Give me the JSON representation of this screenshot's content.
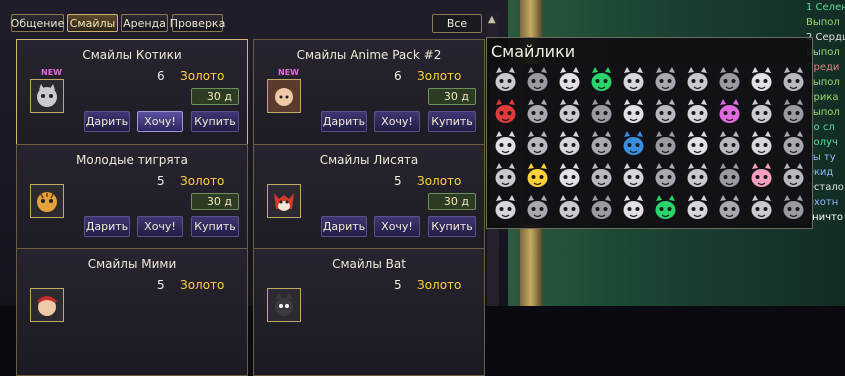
{
  "tabs": [
    {
      "label": "Общение"
    },
    {
      "label": "Смайлы"
    },
    {
      "label": "Аренда"
    },
    {
      "label": "Проверка"
    }
  ],
  "all_label": "Все",
  "cards": [
    {
      "title": "Смайлы Котики",
      "new": "NEW",
      "count": "6",
      "currency": "Золото",
      "price": "30 д",
      "icon": "cat-smile-icon",
      "gift": "Дарить",
      "want": "Хочу!",
      "buy": "Купить"
    },
    {
      "title": "Смайлы Anime Pack #2",
      "new": "NEW",
      "count": "6",
      "currency": "Золото",
      "price": "30 д",
      "icon": "anime-girl-icon",
      "gift": "Дарить",
      "want": "Хочу!",
      "buy": "Купить"
    },
    {
      "title": "Молодые тигрята",
      "count": "5",
      "currency": "Золото",
      "price": "30 д",
      "icon": "tiger-cub-icon",
      "gift": "Дарить",
      "want": "Хочу!",
      "buy": "Купить"
    },
    {
      "title": "Смайлы Лисята",
      "count": "5",
      "currency": "Золото",
      "price": "30 д",
      "icon": "fox-icon",
      "gift": "Дарить",
      "want": "Хочу!",
      "buy": "Купить"
    },
    {
      "title": "Смайлы Мими",
      "count": "5",
      "currency": "Золото",
      "icon": "mimi-icon"
    },
    {
      "title": "Смайлы Bat",
      "count": "5",
      "currency": "Золото",
      "icon": "bat-icon"
    }
  ],
  "popup": {
    "title": "Смайлики"
  },
  "chat_lines": [
    {
      "text": "1 Селен",
      "color": "#57e0a0"
    },
    {
      "text": "Выпол",
      "color": "#9ad86b"
    },
    {
      "text": "2 Сердц",
      "color": "#e0e0e0"
    },
    {
      "text": "Выпол",
      "color": "#9ad86b"
    },
    {
      "text": "Преди",
      "color": "#e08080"
    },
    {
      "text": "Выпол",
      "color": "#9ad86b"
    },
    {
      "text": "Прика",
      "color": "#9ad86b"
    },
    {
      "text": "Выпол",
      "color": "#9ad86b"
    },
    {
      "text": "По сл",
      "color": "#57e0a0"
    },
    {
      "text": "Получ",
      "color": "#57e0a0"
    },
    {
      "text": "Вы ту",
      "color": "#8fb8ff"
    },
    {
      "text": "Окид",
      "color": "#8fb8ff"
    },
    {
      "text": "Остало",
      "color": "#e0e0e0"
    },
    {
      "text": "Охотн",
      "color": "#8fb8ff"
    },
    {
      "text": "Уничто",
      "color": "#ffffff"
    }
  ],
  "colors": {
    "gold": "#ffd23a",
    "button": "#3f3774",
    "border": "#6b5d3d"
  }
}
